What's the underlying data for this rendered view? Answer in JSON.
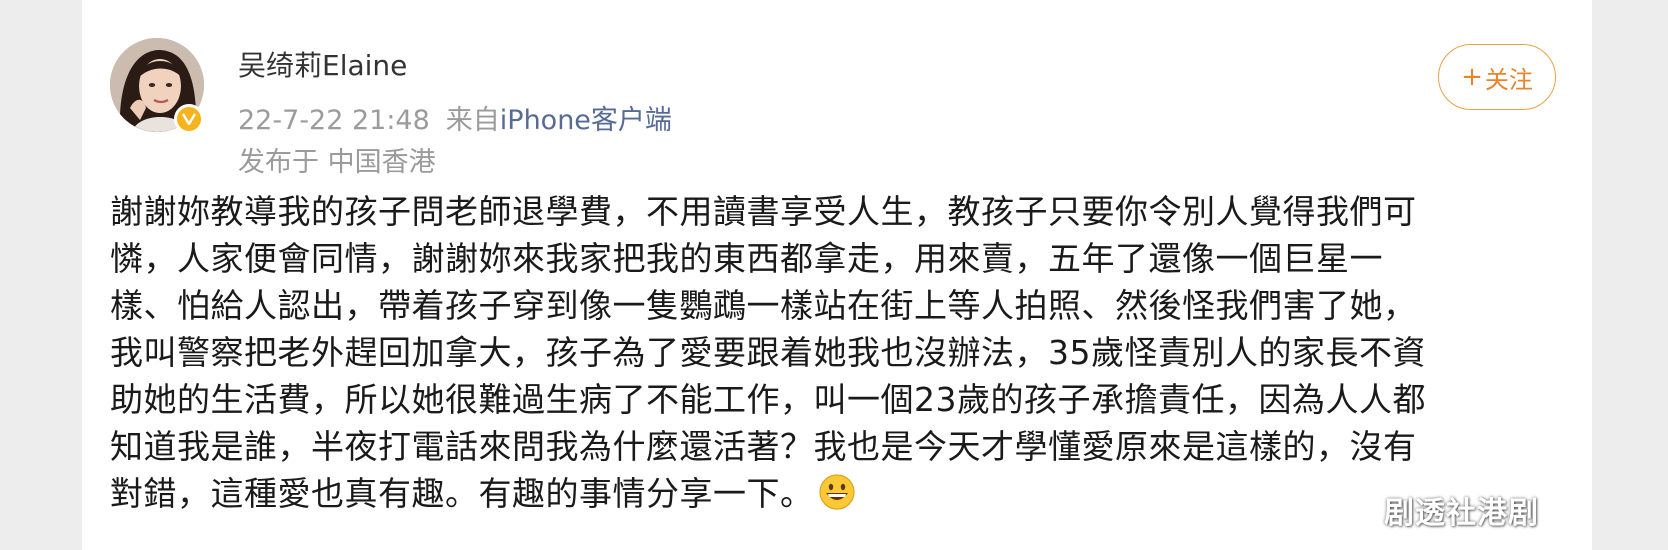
{
  "post": {
    "author": "吴绮莉Elaine",
    "date": "22-7-22 21:48",
    "source_prefix": "来自",
    "source": "iPhone客户端",
    "location": "发布于 中国香港",
    "follow_label": "关注",
    "body_lines": [
      "謝謝妳教導我的孩子問老師退學費，不用讀書享受人生，教孩子只要你令別人覺得我們可",
      "憐，人家便會同情，謝謝妳來我家把我的東西都拿走，用來賣，五年了還像一個巨星一",
      "樣、怕給人認出，帶着孩子穿到像一隻鸚鵡一樣站在街上等人拍照、然後怪我們害了她，",
      "我叫警察把老外趕回加拿大，孩子為了愛要跟着她我也沒辦法，35歲怪責別人的家長不資",
      "助她的生活費，所以她很難過生病了不能工作，叫一個23歲的孩子承擔責任，因為人人都",
      "知道我是誰，半夜打電話來問我為什麼還活著？我也是今天才學懂愛原來是這樣的，沒有",
      "對錯，這種愛也真有趣。有趣的事情分享一下。"
    ]
  },
  "watermark": "剧透社港剧",
  "colors": {
    "follow_accent": "#e8842b",
    "link": "#576b95",
    "meta_gray": "#9b9b9b",
    "verified_badge": "#f6b320"
  },
  "icons": {
    "verified": "verified-badge-icon",
    "follow": "plus-icon",
    "emoji": "grinning-face-emoji-icon"
  }
}
